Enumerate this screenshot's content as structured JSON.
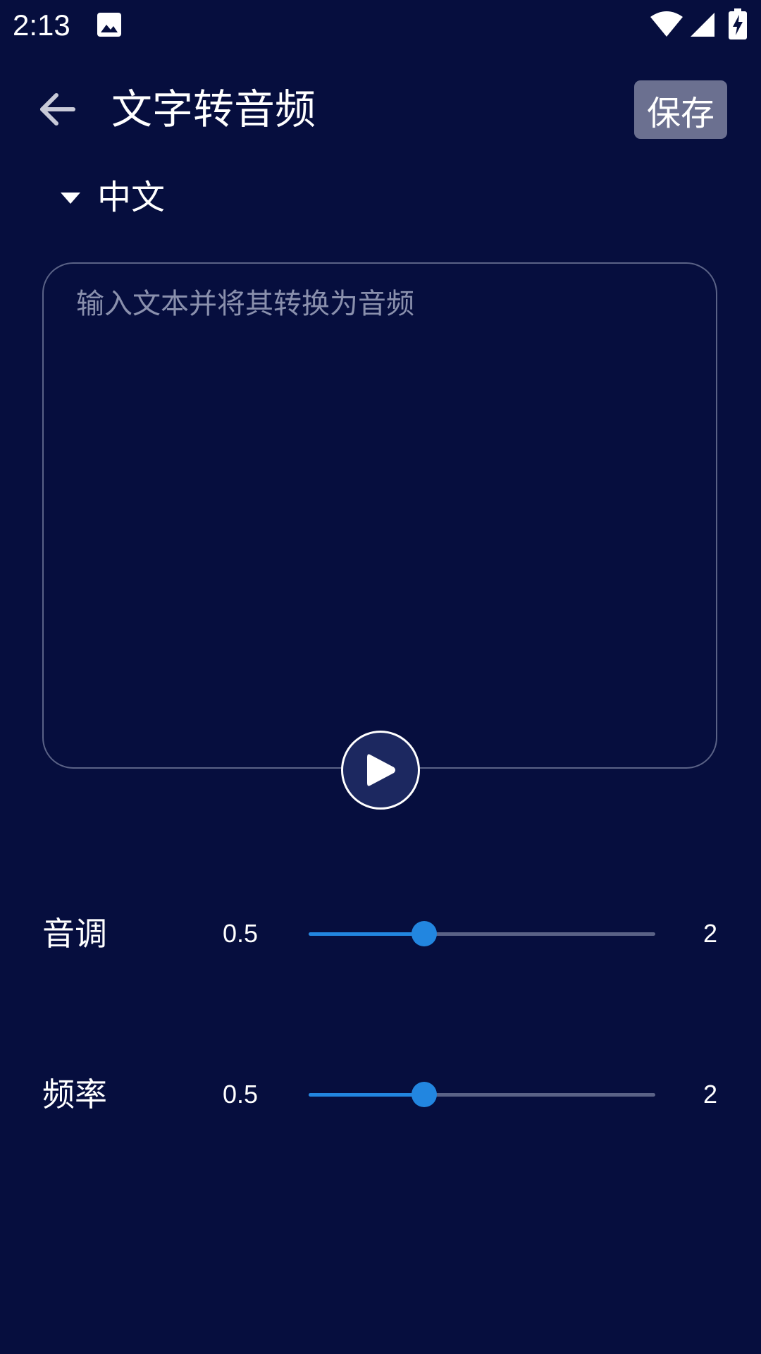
{
  "status_bar": {
    "time": "2:13",
    "icons": [
      "image-icon",
      "wifi-icon",
      "signal-icon",
      "battery-charging-icon"
    ]
  },
  "header": {
    "back_icon": "arrow-left-icon",
    "title": "文字转音频",
    "save_label": "保存"
  },
  "language": {
    "dropdown_icon": "triangle-down-icon",
    "selected": "中文"
  },
  "text_input": {
    "value": "",
    "placeholder": "输入文本并将其转换为音频"
  },
  "play": {
    "icon": "play-icon"
  },
  "sliders": [
    {
      "label": "音调",
      "min_label": "0.5",
      "max_label": "2",
      "min": 0.5,
      "max": 2,
      "value": 1.0
    },
    {
      "label": "频率",
      "min_label": "0.5",
      "max_label": "2",
      "min": 0.5,
      "max": 2,
      "value": 1.0
    }
  ],
  "colors": {
    "background": "#060e3e",
    "accent": "#2286e0",
    "save_button": "#6b7090",
    "border": "#5a6286"
  }
}
